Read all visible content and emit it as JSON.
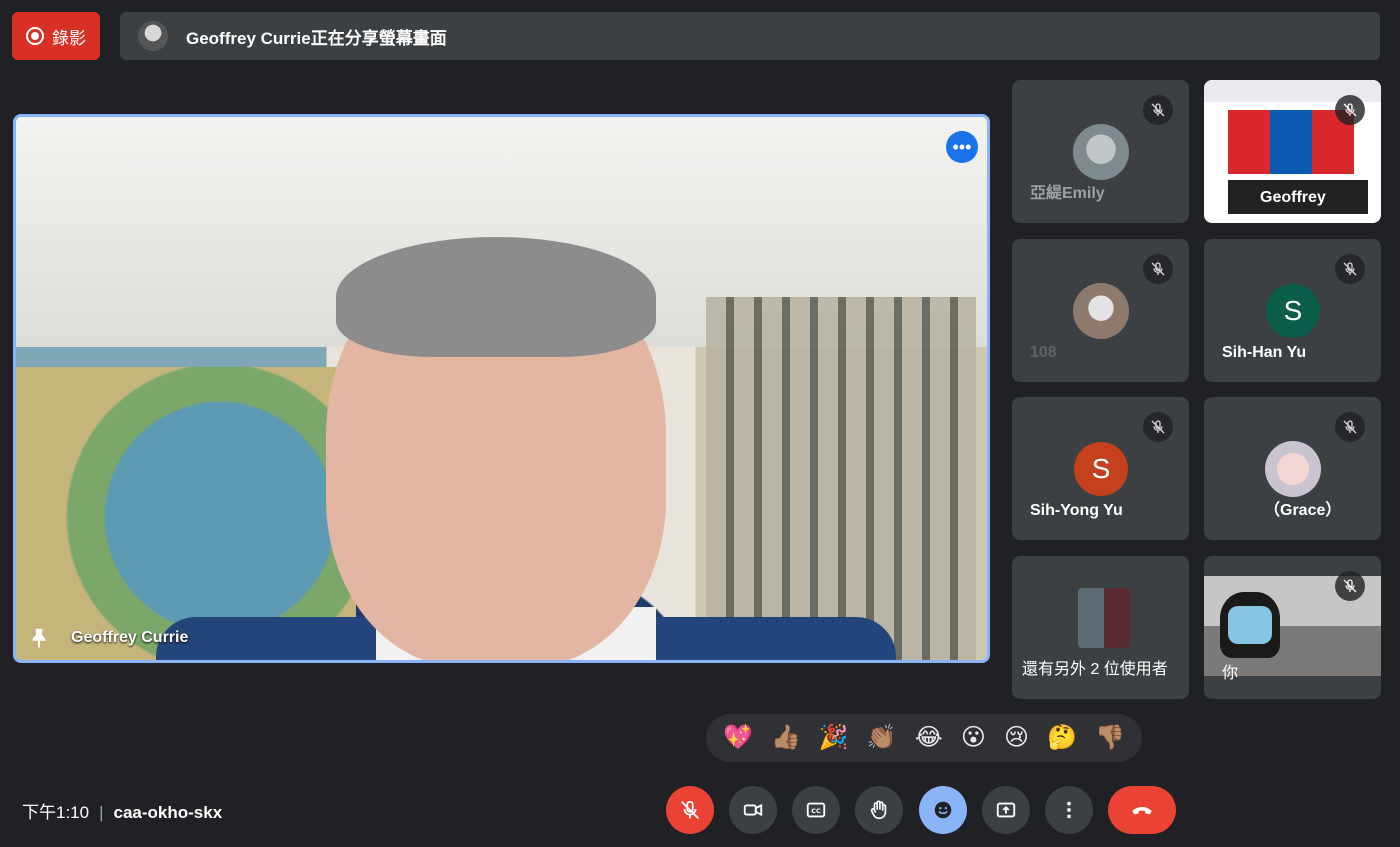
{
  "top_bar": {
    "record_label": "錄影",
    "share_text": "Geoffrey Currie正在分享螢幕畫面"
  },
  "main_stage": {
    "speaker_name": "Geoffrey Currie"
  },
  "participants": [
    {
      "name": "亞緹Emily",
      "type": "photo",
      "muted": true
    },
    {
      "name": "Geoffrey",
      "type": "screen-share",
      "muted": true
    },
    {
      "name": "108",
      "type": "photo",
      "muted": true
    },
    {
      "name": "Sih-Han Yu",
      "type": "letter",
      "letter": "S",
      "color": "#0b5e4a",
      "muted": true
    },
    {
      "name": "Sih-Yong Yu",
      "type": "letter",
      "letter": "S",
      "color": "#c5401c",
      "muted": true
    },
    {
      "name": "（Grace）",
      "type": "photo",
      "muted": true
    },
    {
      "name": "還有另外 2 位使用者",
      "type": "more",
      "muted": false
    },
    {
      "name": "你",
      "type": "video",
      "muted": true
    }
  ],
  "reactions": [
    "💖",
    "👍🏽",
    "🎉",
    "👏🏽",
    "😂",
    "😮",
    "😢",
    "🤔",
    "👎🏽"
  ],
  "bottom_bar": {
    "time": "下午1:10",
    "meeting_code": "caa-okho-skx"
  },
  "colors": {
    "background": "#202124",
    "tile": "#3c4043",
    "accent_blue": "#8ab4f8",
    "danger_red": "#ea4335"
  }
}
